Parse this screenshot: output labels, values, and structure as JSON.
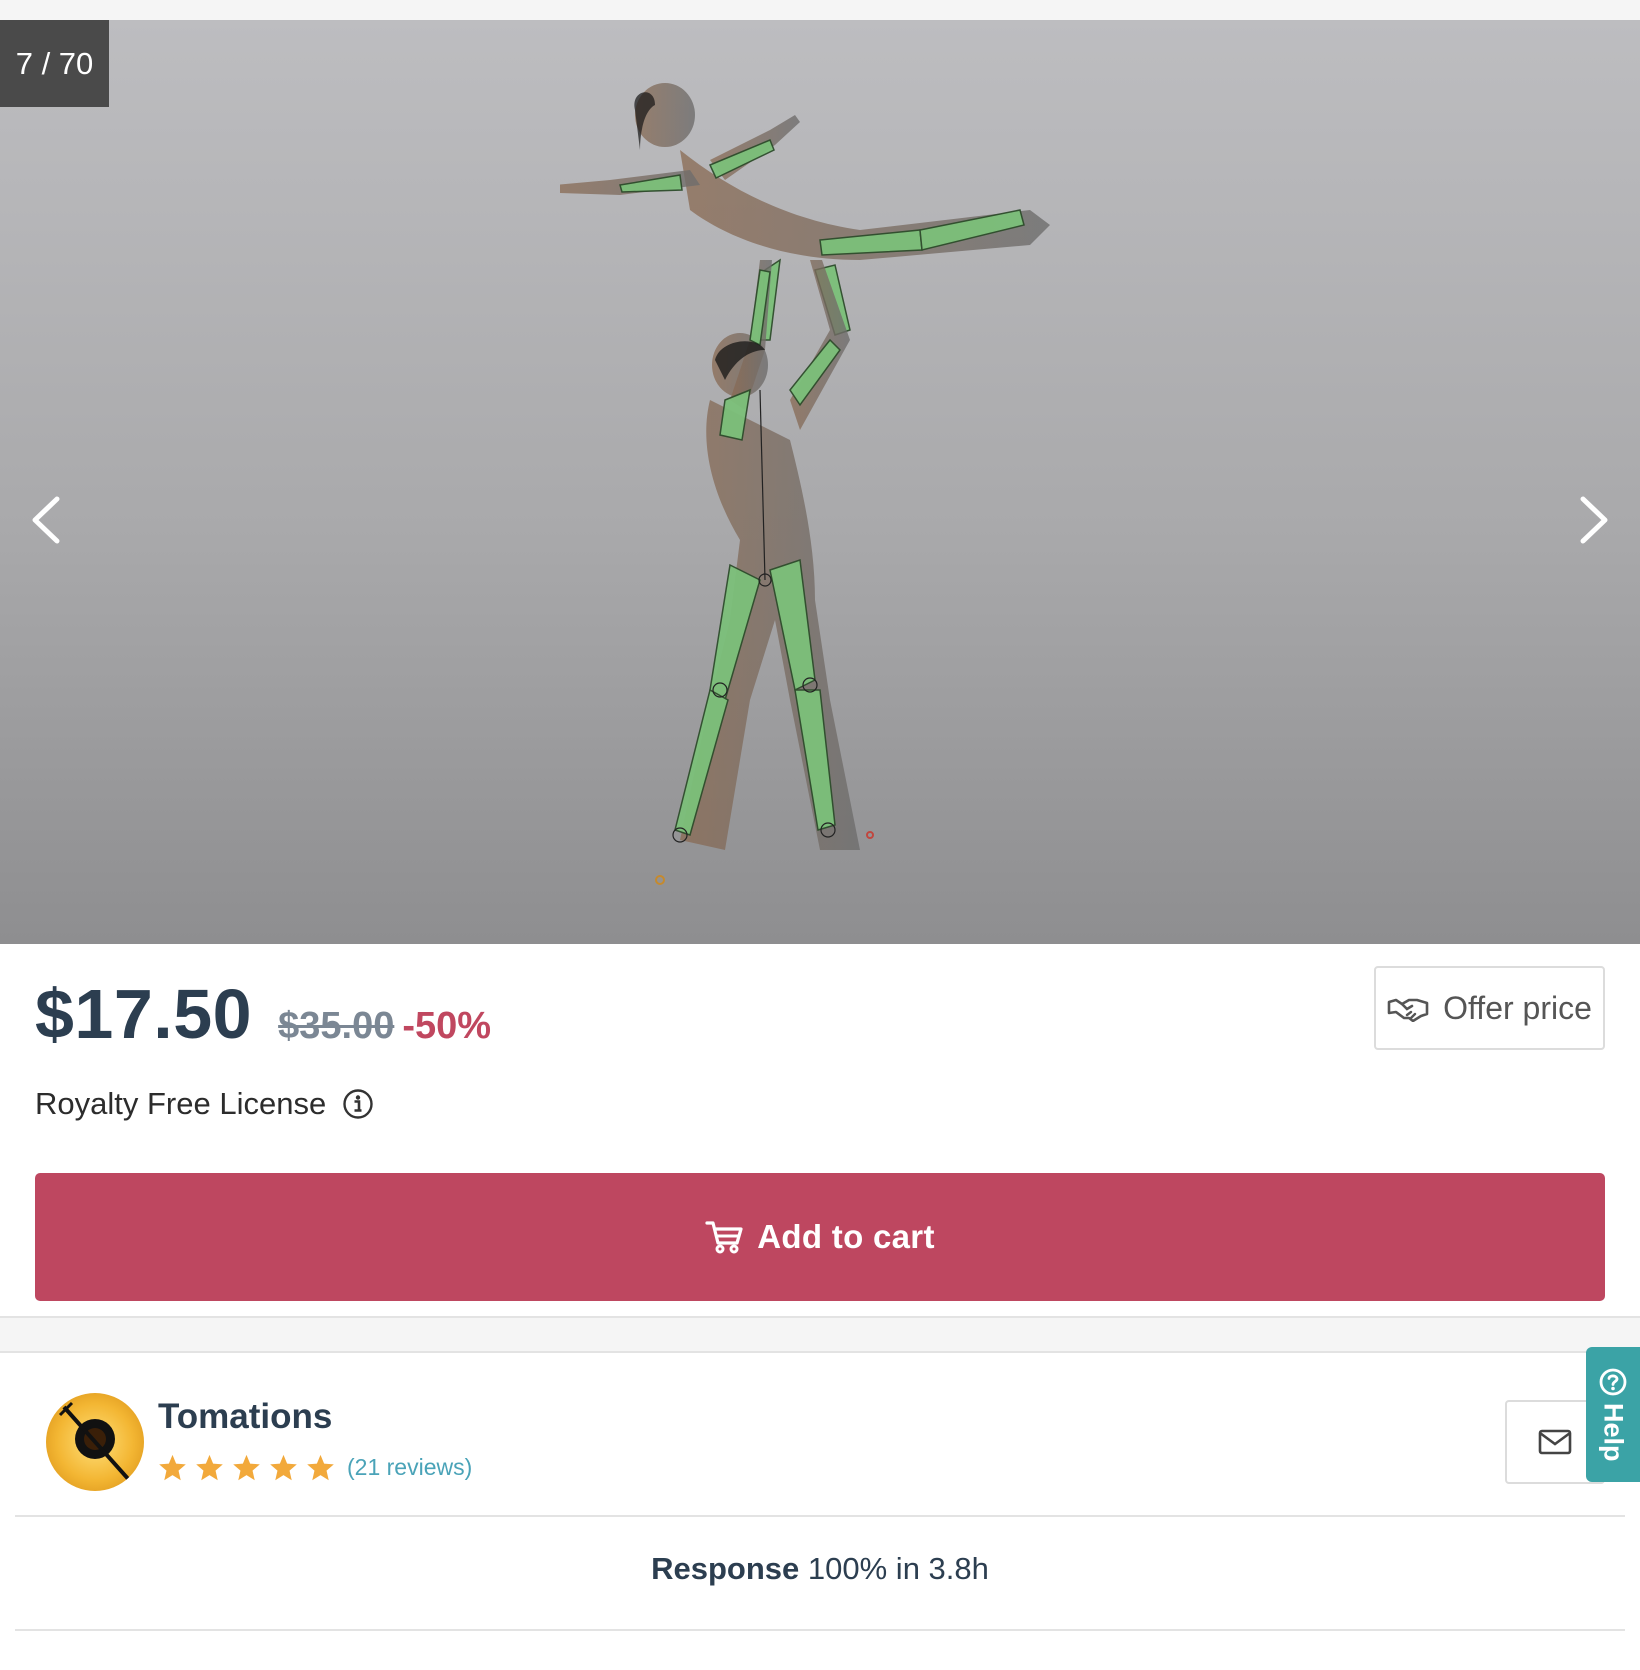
{
  "gallery": {
    "counter": "7 / 70",
    "prev_icon": "chevron-left-icon",
    "next_icon": "chevron-right-icon"
  },
  "pricing": {
    "current": "$17.50",
    "original": "$35.00",
    "discount": "-50%",
    "offer_label": "Offer price",
    "license": "Royalty Free License",
    "cart_label": "Add to cart"
  },
  "seller": {
    "name": "Tomations",
    "rating": 5,
    "reviews": "(21 reviews)",
    "response_label": "Response",
    "response_value": "100% in 3.8h"
  },
  "help": {
    "label": "Help"
  },
  "colors": {
    "accent": "#be4760",
    "text": "#2c3e50",
    "star": "#f2a93b",
    "link": "#4aa3b8",
    "help": "#3ba3a6"
  }
}
